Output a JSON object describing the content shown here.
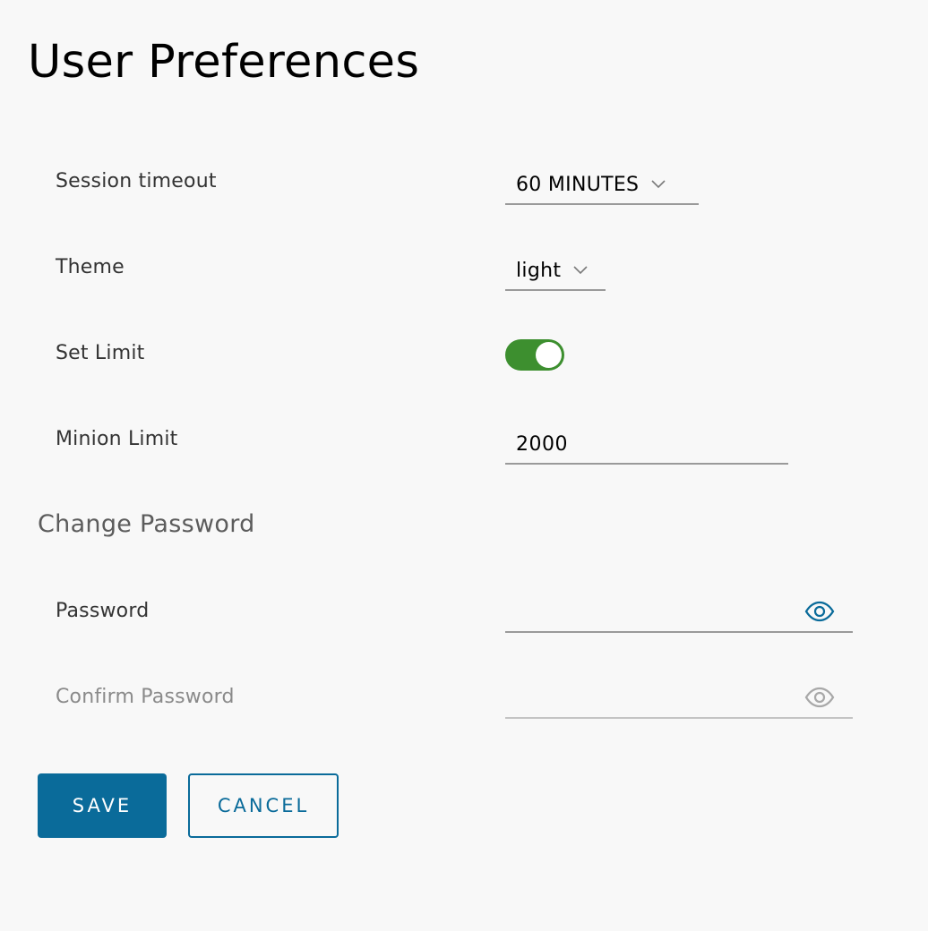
{
  "page": {
    "title": "User Preferences"
  },
  "settings": {
    "session_timeout": {
      "label": "Session timeout",
      "value": "60 MINUTES"
    },
    "theme": {
      "label": "Theme",
      "value": "light"
    },
    "set_limit": {
      "label": "Set Limit",
      "enabled": true
    },
    "minion_limit": {
      "label": "Minion Limit",
      "value": "2000"
    }
  },
  "change_password": {
    "title": "Change Password",
    "password": {
      "label": "Password",
      "value": "",
      "icon": "eye-icon"
    },
    "confirm_password": {
      "label": "Confirm Password",
      "value": "",
      "disabled": true,
      "icon": "eye-icon"
    }
  },
  "actions": {
    "save_label": "SAVE",
    "cancel_label": "CANCEL"
  },
  "colors": {
    "primary": "#0a6b9a",
    "toggle_on": "#3d8f2f",
    "background": "#f8f8f8"
  }
}
